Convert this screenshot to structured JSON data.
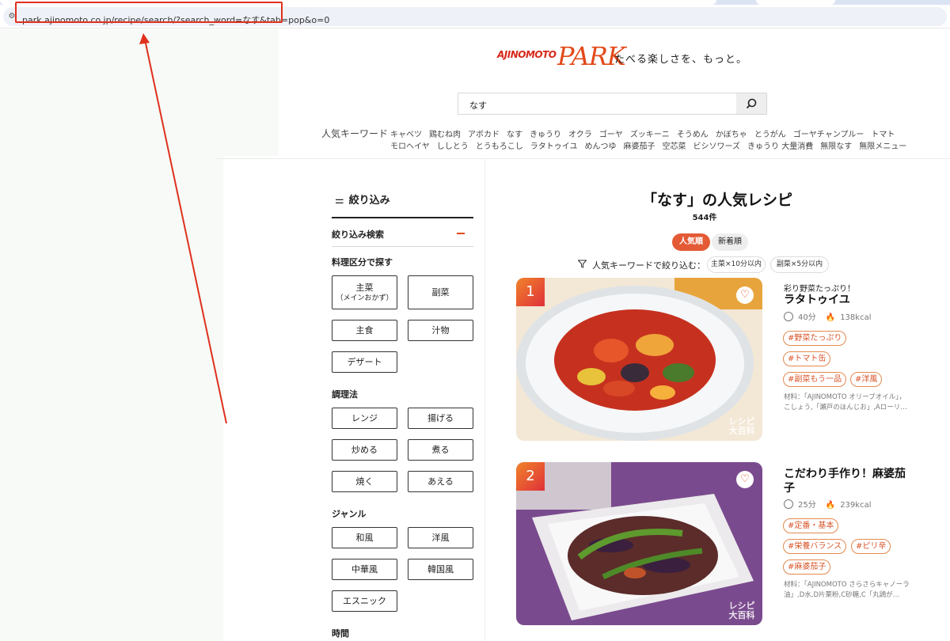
{
  "browser": {
    "url": "park.ajinomoto.co.jp/recipe/search/?search_word=なす&tab=pop&o=0",
    "site_info_icon": "tune-icon"
  },
  "header": {
    "logo_ajinomoto": "AJINOMOTO",
    "logo_park": "PARK",
    "tagline": "たべる楽しさを、もっと。"
  },
  "search": {
    "value": "なす",
    "button_icon": "search-icon"
  },
  "keywords": {
    "label": "人気キーワード",
    "row1": [
      "キャベツ",
      "鶏むね肉",
      "アボカド",
      "なす",
      "きゅうり",
      "オクラ",
      "ゴーヤ",
      "ズッキーニ",
      "そうめん",
      "かぼちゃ",
      "とうがん",
      "ゴーヤチャンプルー",
      "トマト"
    ],
    "row2": [
      "モロヘイヤ",
      "ししとう",
      "とうもろこし",
      "ラタトゥイユ",
      "めんつゆ",
      "麻婆茄子",
      "空芯菜",
      "ビシソワーズ",
      "きゅうり 大量消費",
      "無限なす",
      "無限メニュー"
    ]
  },
  "filter": {
    "title": "絞り込み",
    "subhead": "絞り込み検索",
    "category_label": "料理区分で探す",
    "category": [
      {
        "line1": "主菜",
        "line2": "（メインおかず）"
      },
      {
        "line1": "副菜",
        "line2": ""
      },
      {
        "line1": "主食",
        "line2": ""
      },
      {
        "line1": "汁物",
        "line2": ""
      },
      {
        "line1": "デザート",
        "line2": ""
      }
    ],
    "method_label": "調理法",
    "method": [
      "レンジ",
      "揚げる",
      "炒める",
      "煮る",
      "焼く",
      "あえる"
    ],
    "genre_label": "ジャンル",
    "genre": [
      "和風",
      "洋風",
      "中華風",
      "韓国風",
      "エスニック"
    ],
    "time_label": "時間"
  },
  "results": {
    "title": "「なす」の人気レシピ",
    "count": "544件",
    "sort_popular": "人気順",
    "sort_new": "新着順",
    "kw_filter_label": "人気キーワードで絞り込む：",
    "kw_chips": [
      "主菜×10分以内",
      "副菜×5分以内"
    ]
  },
  "recipes": [
    {
      "rank": "1",
      "catch": "彩り野菜たっぷり！",
      "name": "ラタトゥイユ",
      "time": "40分",
      "kcal": "138kcal",
      "tags": [
        "#野菜たっぷり",
        "#トマト缶",
        "#副菜もう一品",
        "#洋風"
      ],
      "ingredients": "材料：「AJINOMOTO オリーブオイル」，こしょう,「瀬戸のほんじお」,Aローリ…",
      "watermark": "レシピ大百科"
    },
    {
      "rank": "2",
      "catch": "",
      "name": "こだわり手作り！麻婆茄子",
      "time": "25分",
      "kcal": "239kcal",
      "tags": [
        "#定番・基本",
        "#栄養バランス",
        "#ピリ辛",
        "#麻婆茄子"
      ],
      "ingredients": "材料：「AJINOMOTO さらさらキャノーラ油」,D水,D片栗粉,C砂糖,C「丸鶏が…",
      "watermark": "レシピ大百科"
    }
  ],
  "colors": {
    "accent": "#e35a35",
    "annotation": "#e0301e"
  }
}
